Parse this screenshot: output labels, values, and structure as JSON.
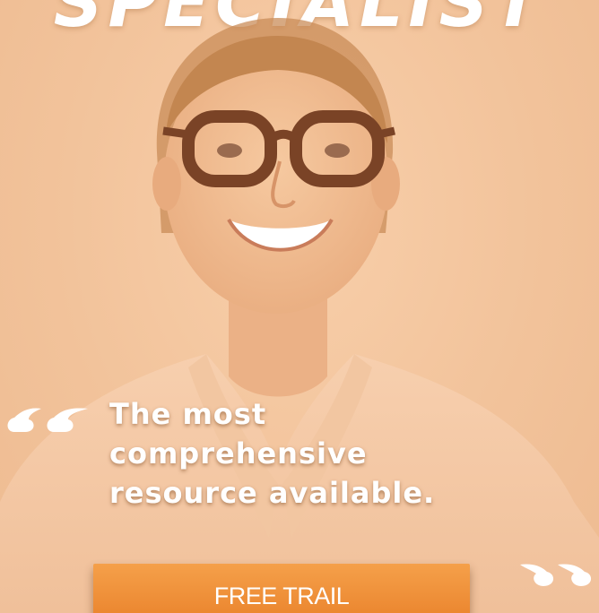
{
  "ad": {
    "headline": "SPECIALIST",
    "quote": {
      "line1": "The most",
      "line2": "comprehensive",
      "line3": "resource available."
    },
    "cta_label": "FREE TRAIL"
  },
  "icons": {
    "photo": "person-photo",
    "quote_open": "open-quote-icon",
    "quote_close": "close-quote-icon"
  },
  "colors": {
    "background": "#f2c39b",
    "cta": "#ee8a30",
    "text": "#ffffff"
  }
}
